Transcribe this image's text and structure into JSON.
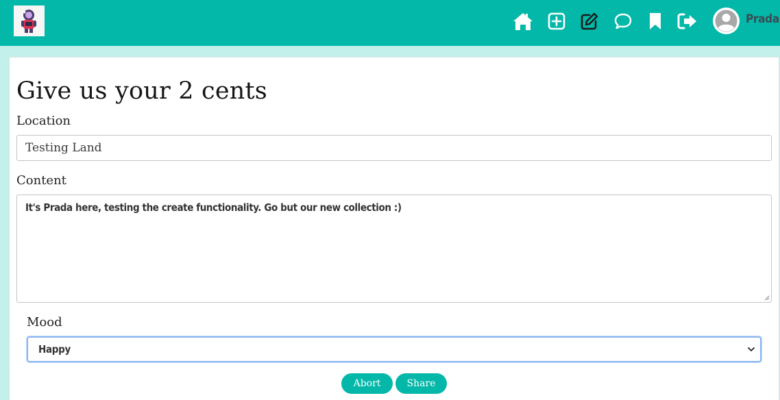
{
  "header": {
    "username": "Prada",
    "nav": [
      {
        "icon": "home-icon"
      },
      {
        "icon": "add-square-icon"
      },
      {
        "icon": "edit-icon"
      },
      {
        "icon": "chat-icon"
      },
      {
        "icon": "bookmark-icon"
      },
      {
        "icon": "logout-icon"
      }
    ],
    "colors": {
      "bar": "#03b8a8",
      "active_icon": "#1a1a1a",
      "icon": "#ffffff"
    }
  },
  "form": {
    "title": "Give us your 2 cents",
    "location_label": "Location",
    "location_value": "Testing Land",
    "content_label": "Content",
    "content_value": "It's Prada here, testing the create functionality. Go but our new collection :)",
    "mood_label": "Mood",
    "mood_value": "Happy",
    "abort_label": "Abort",
    "share_label": "Share"
  }
}
